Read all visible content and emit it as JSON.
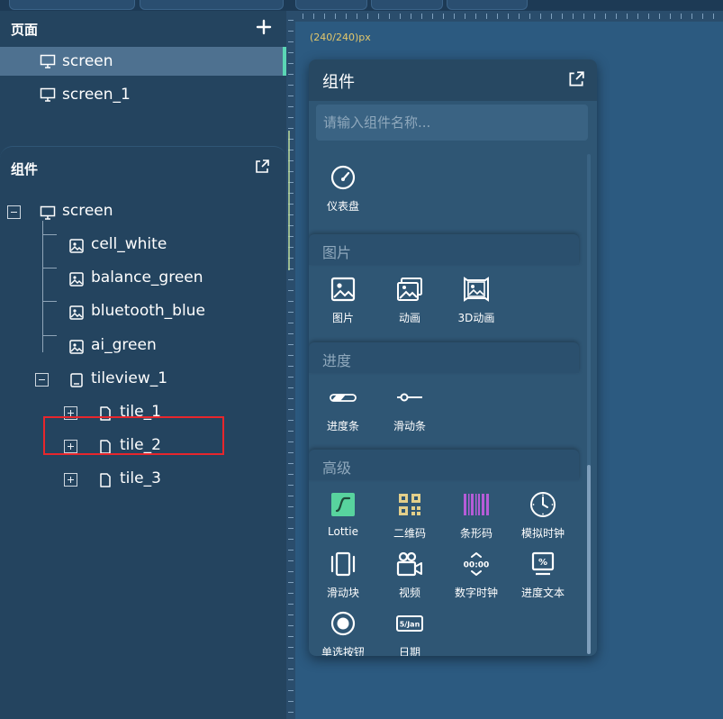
{
  "pages_panel": {
    "title": "页面",
    "pages": [
      {
        "label": "screen"
      },
      {
        "label": "screen_1"
      }
    ]
  },
  "components_panel": {
    "title": "组件",
    "tree": {
      "root": "screen",
      "children": [
        "cell_white",
        "balance_green",
        "bluetooth_blue",
        "ai_green"
      ],
      "tileview": "tileview_1",
      "tiles": [
        "tile_1",
        "tile_2",
        "tile_3"
      ]
    }
  },
  "canvas": {
    "size_label": "(240/240)px"
  },
  "palette": {
    "title": "组件",
    "search_placeholder": "请输入组件名称...",
    "sections": {
      "gauge": {
        "items": [
          "仪表盘"
        ]
      },
      "image": {
        "title": "图片",
        "items": [
          "图片",
          "动画",
          "3D动画"
        ]
      },
      "progress": {
        "title": "进度",
        "items": [
          "进度条",
          "滑动条"
        ]
      },
      "advanced": {
        "title": "高级",
        "items": [
          "Lottie",
          "二维码",
          "条形码",
          "模拟时钟",
          "滑动块",
          "视频",
          "数字时钟",
          "进度文本",
          "单选按钮",
          "日期"
        ]
      }
    },
    "icon_text": {
      "digital_clock": "00:00",
      "progress_text": "%",
      "date": "5/Jan"
    }
  },
  "colors": {
    "accent": "#5bd6b5",
    "highlight": "#e8262c",
    "lottie": "#58d39e",
    "qrcode": "#e3cf8a",
    "barcode": "#b65cd8"
  }
}
